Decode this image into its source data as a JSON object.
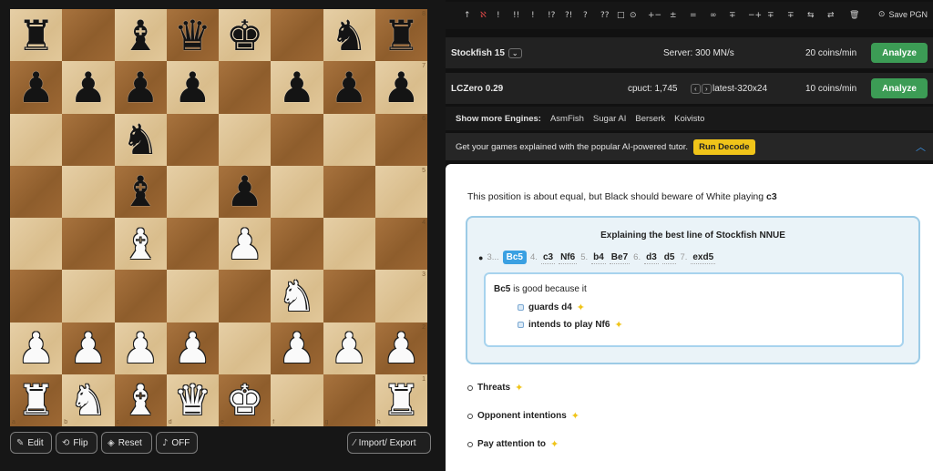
{
  "board": {
    "ranks": [
      "8",
      "7",
      "6",
      "5",
      "4",
      "3",
      "2",
      "1"
    ],
    "files": [
      "a",
      "b",
      "c",
      "d",
      "e",
      "f",
      "g",
      "h"
    ],
    "position": [
      [
        "br",
        "",
        "bb",
        "bq",
        "bk",
        "",
        "bn",
        "br"
      ],
      [
        "bp",
        "bp",
        "bp",
        "bp",
        "",
        "bp",
        "bp",
        "bp"
      ],
      [
        "",
        "",
        "bn",
        "",
        "",
        "",
        "",
        ""
      ],
      [
        "",
        "",
        "bb",
        "",
        "bp",
        "",
        "",
        ""
      ],
      [
        "",
        "",
        "wb",
        "",
        "wp",
        "",
        "",
        ""
      ],
      [
        "",
        "",
        "",
        "",
        "",
        "wn",
        "",
        ""
      ],
      [
        "wp",
        "wp",
        "wp",
        "wp",
        "",
        "wp",
        "wp",
        "wp"
      ],
      [
        "wr",
        "wn",
        "wb",
        "wq",
        "wk",
        "",
        "",
        "wr"
      ]
    ],
    "glyphs": {
      "k": "♚",
      "q": "♛",
      "r": "♜",
      "b": "♝",
      "n": "♞",
      "p": "♟"
    }
  },
  "board_tools": {
    "edit_label": "Edit",
    "flip_label": "Flip",
    "reset_label": "Reset",
    "sound_label": "OFF",
    "import_export_label": "Import/ Export"
  },
  "annotation_bar": {
    "symbols": [
      "↑",
      "ℵ",
      "!",
      "!!",
      "!",
      "!?",
      "?!",
      "?",
      "??",
      "□",
      "⊙",
      "+−",
      "±",
      "=",
      "∞",
      "∓",
      "−+",
      "∓",
      "∓",
      "⇆",
      "⇄",
      "🗑"
    ],
    "save_label": "Save PGN"
  },
  "engines": [
    {
      "name": "Stockfish 15",
      "server": "Server: 300 MN/s",
      "cost": "20 coins/min",
      "analyze_label": "Analyze"
    },
    {
      "name": "LCZero 0.29",
      "cpuct": "cpuct: 1,745",
      "net": "latest-320x24",
      "cost": "10 coins/min",
      "analyze_label": "Analyze"
    }
  ],
  "more_engines": {
    "label": "Show more Engines:",
    "items": [
      "AsmFish",
      "Sugar AI",
      "Berserk",
      "Koivisto"
    ]
  },
  "decode_banner": {
    "text": "Get your games explained with the popular AI-powered tutor.",
    "button_label": "Run Decode"
  },
  "explanation": {
    "summary_prefix": "This position is about equal, but Black should beware of White playing",
    "summary_move": "c3",
    "line_title": "Explaining the best line of Stockfish NNUE",
    "moves": [
      {
        "num": "3...",
        "san": "Bc5",
        "active": true
      },
      {
        "num": "4.",
        "san": "c3"
      },
      {
        "num": "",
        "san": "Nf6"
      },
      {
        "num": "5.",
        "san": "b4"
      },
      {
        "num": "",
        "san": "Be7"
      },
      {
        "num": "6.",
        "san": "d3"
      },
      {
        "num": "",
        "san": "d5"
      },
      {
        "num": "7.",
        "san": "exd5"
      }
    ],
    "reason_move": "Bc5",
    "reason_text": "is good because it",
    "reasons": [
      "guards d4",
      "intends to play Nf6"
    ],
    "sections": [
      "Threats",
      "Opponent intentions",
      "Pay attention to"
    ]
  }
}
